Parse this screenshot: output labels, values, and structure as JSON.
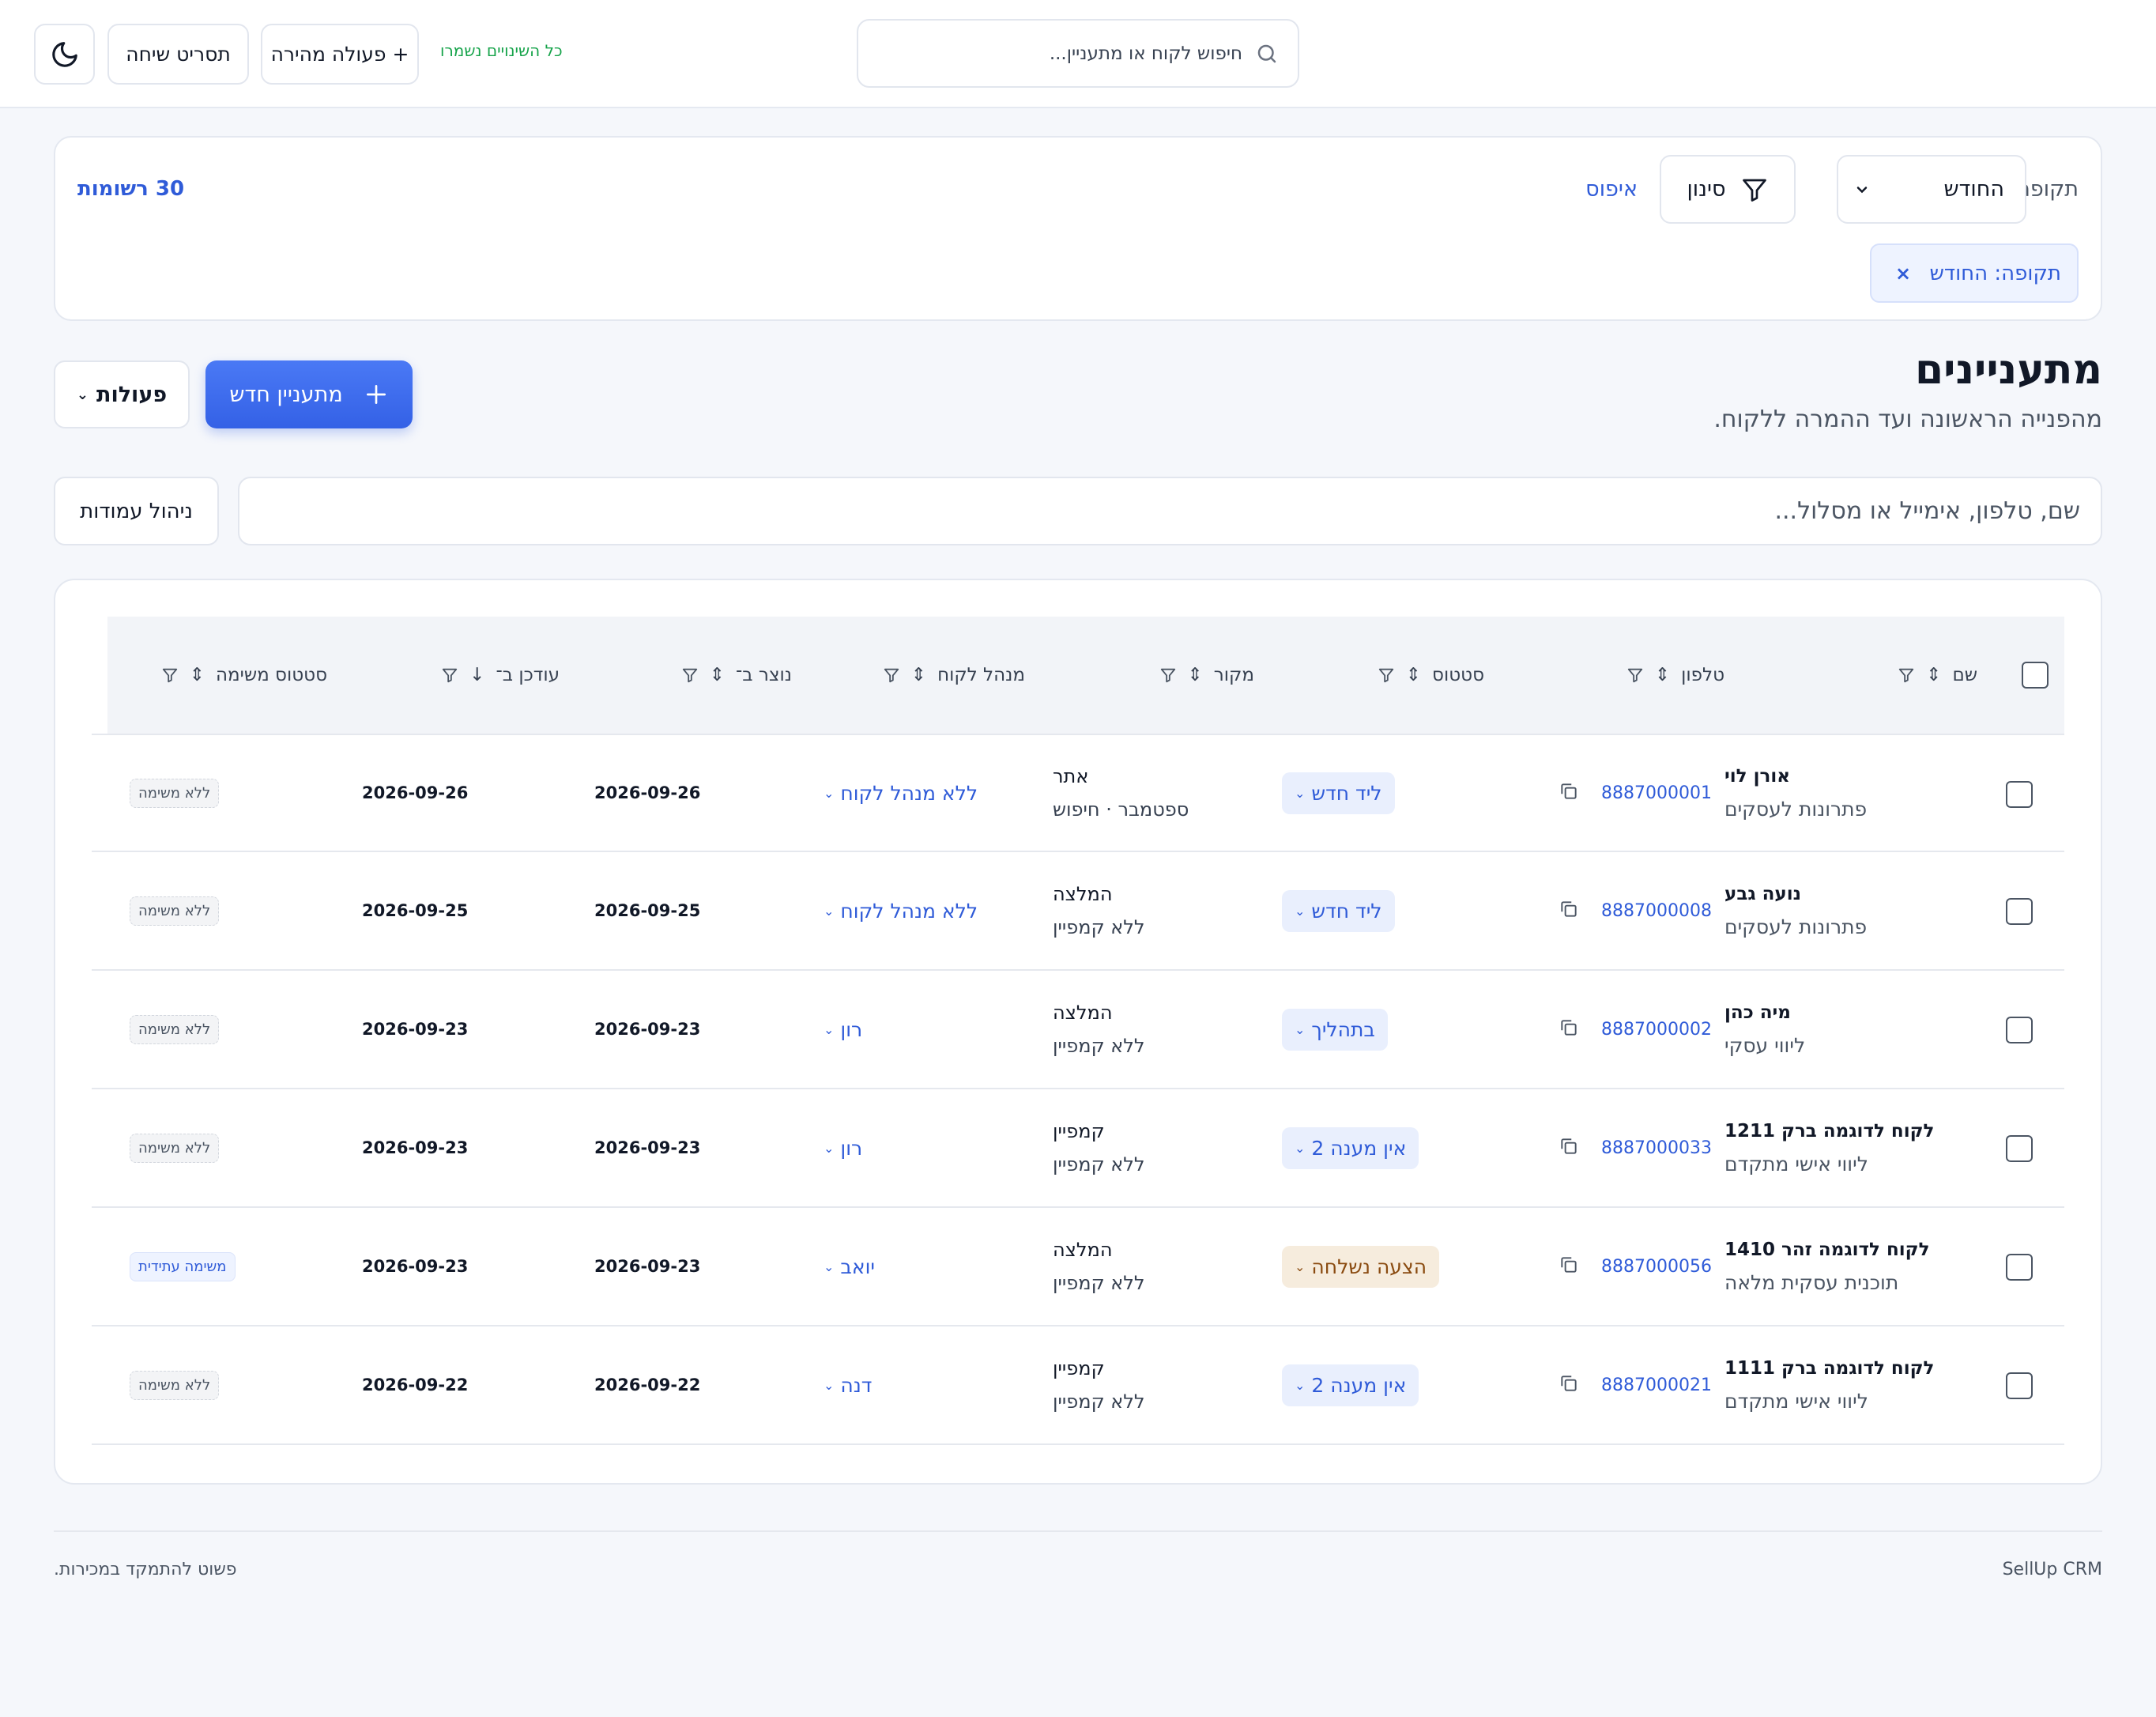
{
  "topbar": {
    "search_placeholder": "חיפוש לקוח או מתעניין...",
    "saved_status": "כל השינויים נשמרו",
    "quick_action_label": "+ פעולה מהירה",
    "call_script_label": "תסריט שיחה",
    "theme_icon": "moon-icon"
  },
  "filters": {
    "period_label": "תקופה",
    "period_value": "החודש",
    "filter_label": "סינון",
    "reset_label": "איפוס",
    "records_count": "30 רשומות",
    "active_chip": "תקופה: החודש",
    "chip_close": "×"
  },
  "header": {
    "title": "מתעניינים",
    "subtitle": "מהפנייה הראשונה ועד ההמרה ללקוח.",
    "new_lead_label": "מתעניין חדש",
    "actions_label": "פעולות"
  },
  "search": {
    "placeholder": "שם, טלפון, אימייל או מסלול...",
    "columns_label": "ניהול עמודות"
  },
  "table": {
    "columns": {
      "name": "שם",
      "phone": "טלפון",
      "status": "סטטוס",
      "source": "מקור",
      "manager": "מנהל לקוח",
      "created": "נוצר ב־",
      "updated": "עודכן ב־",
      "task_status": "סטטוס משימה"
    },
    "rows": [
      {
        "name": "אורן לוי",
        "track": "פתרונות לעסקים",
        "phone": "8887000001",
        "status": "ליד חדש",
        "status_kind": "new",
        "source": "אתר",
        "campaign": "ספטמבר · חיפוש",
        "manager": "ללא מנהל לקוח",
        "created": "2026-09-26",
        "updated": "2026-09-26",
        "task": "ללא משימה",
        "task_kind": "none"
      },
      {
        "name": "נועה גבע",
        "track": "פתרונות לעסקים",
        "phone": "8887000008",
        "status": "ליד חדש",
        "status_kind": "new",
        "source": "המלצה",
        "campaign": "ללא קמפיין",
        "manager": "ללא מנהל לקוח",
        "created": "2026-09-25",
        "updated": "2026-09-25",
        "task": "ללא משימה",
        "task_kind": "none"
      },
      {
        "name": "מיה כהן",
        "track": "ליווי עסקי",
        "phone": "8887000002",
        "status": "בתהליך",
        "status_kind": "progress",
        "source": "המלצה",
        "campaign": "ללא קמפיין",
        "manager": "רון",
        "created": "2026-09-23",
        "updated": "2026-09-23",
        "task": "ללא משימה",
        "task_kind": "none"
      },
      {
        "name": "לקוח לדוגמה ברק 1211",
        "track": "ליווי אישי מתקדם",
        "phone": "8887000033",
        "status": "אין מענה 2",
        "status_kind": "noanswer",
        "source": "קמפיין",
        "campaign": "ללא קמפיין",
        "manager": "רון",
        "created": "2026-09-23",
        "updated": "2026-09-23",
        "task": "ללא משימה",
        "task_kind": "none"
      },
      {
        "name": "לקוח לדוגמה זהר 1410",
        "track": "תוכנית עסקית מלאה",
        "phone": "8887000056",
        "status": "הצעה נשלחה",
        "status_kind": "offer",
        "source": "המלצה",
        "campaign": "ללא קמפיין",
        "manager": "יואב",
        "created": "2026-09-23",
        "updated": "2026-09-23",
        "task": "משימה עתידית",
        "task_kind": "future"
      },
      {
        "name": "לקוח לדוגמה ברק 1111",
        "track": "ליווי אישי מתקדם",
        "phone": "8887000021",
        "status": "אין מענה 2",
        "status_kind": "noanswer",
        "source": "קמפיין",
        "campaign": "ללא קמפיין",
        "manager": "דנה",
        "created": "2026-09-22",
        "updated": "2026-09-22",
        "task": "ללא משימה",
        "task_kind": "none"
      }
    ]
  },
  "footer": {
    "brand": "SellUp CRM",
    "tagline": "פשוט להתמקד במכירות."
  },
  "colors": {
    "accent": "#3461e6",
    "link": "#2f5bd8",
    "saved": "#16a34a",
    "offer_bg": "#f6ecdd",
    "offer_text": "#8a4b10"
  }
}
